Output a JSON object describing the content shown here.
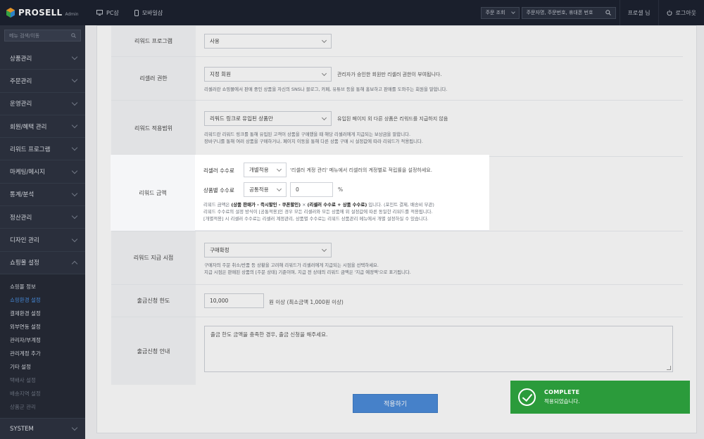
{
  "app": {
    "brand": "PROSELL",
    "brand_sub": "Admin"
  },
  "topbar": {
    "nav": [
      {
        "icon": "monitor-icon",
        "label": "PC샵"
      },
      {
        "icon": "mobile-icon",
        "label": "모바일샵"
      }
    ],
    "order_select": "주문 조회",
    "order_search_placeholder": "주문자명, 주문번호, 휴대폰 번호",
    "profile": "프로셀 님",
    "logout": "로그아웃"
  },
  "sidebar": {
    "search_placeholder": "메뉴 검색/이동",
    "menu": [
      "상품관리",
      "주문관리",
      "운영관리",
      "회원/혜택 관리",
      "리워드 프로그램",
      "마케팅/메시지",
      "통계/분석",
      "정산관리",
      "디자인 관리",
      "쇼핑몰 설정"
    ],
    "sub": [
      "쇼핑몰 정보",
      "쇼핑환경 설정",
      "결제환경 설정",
      "외부연동 설정",
      "관리자/부계정",
      "관리계정 추가",
      "기타 설정",
      "택배사 설정",
      "배송지역 설정",
      "상품군 관리"
    ],
    "system": "SYSTEM"
  },
  "form": {
    "reward_program": {
      "label": "리워드 프로그램",
      "value": "사용"
    },
    "reseller_auth": {
      "label": "리셀러 권한",
      "value": "지정 회원",
      "note": "관리자가 승인한 회원만 리셀러 권한이 부여됩니다.",
      "help": "리셀러란 쇼핑몰에서 판매 중인 상품을 자신의 SNS나 블로그, 카페, 유튜브 등을 통해 홍보하고 판매를 도와주는 회원을 말합니다."
    },
    "reward_scope": {
      "label": "리워드 적용범위",
      "value": "리워드 링크로 유입된 상품만",
      "note": "유입된 페이지 외 다른 상품은 리워드를 지급하지 않음",
      "help1": "리워드란 리워드 링크를 통해 유입된 고객이 상품을 구매했을 때 해당 리셀러에게 지급되는 보상금을 말합니다.",
      "help2": "장바구니를 통해 여러 상품을 구매하거나, 페이지 이동을 통해 다른 상품 구매 시 설정값에 따라 리워드가 적용됩니다."
    },
    "reward_amount": {
      "label": "리워드 금액",
      "reseller_rate_label": "리셀러 수수료",
      "reseller_rate_value": "개별적용",
      "reseller_rate_note": "'리셀러 계정 관리' 메뉴에서 리셀러의 계정별로 적립률을 설정하세요.",
      "product_rate_label": "상품별 수수료",
      "product_rate_value": "공통적용",
      "product_rate_input": "0",
      "product_rate_unit": "%",
      "help1_pre": "리워드 금액은 ",
      "help1_bold1": "(상품 판매가 - 즉시할인 - 쿠폰할인)",
      "help1_mid": " × ",
      "help1_bold2": "(리셀러 수수료 + 상품 수수료)",
      "help1_post": " 입니다. (포인트 결제, 배송비 무관)",
      "help2": "리워드 수수료의 설정 방식이 [공통적용]인 경우 모든 리셀러와 모든 상품에 위 설정값에 따른 동일한 리워드를 적용됩니다.",
      "help3": "[개별적용] 시 리셀러 수수료는 리셀러 계정관리, 상품별 수수료는 리워드 상품관리 메뉴에서 개별 설정하실 수 있습니다."
    },
    "payout_time": {
      "label": "리워드 지급 시점",
      "value": "구매확정",
      "help1": "구매자의 주문 취소/반품 등 상황을 고려해 리워드가 리셀러에게 지급되는 시점을 선택하세요.",
      "help2": "지급 시점은 판매된 상품의 [주문 상태] 기준이며, 지급 전 상태의 리워드 금액은 '지급 예정액'으로 표기됩니다."
    },
    "withdraw_limit": {
      "label": "출금신청 한도",
      "value": "10,000",
      "note": "원 이상 (최소금액 1,000원 이상)"
    },
    "withdraw_notice": {
      "label": "출금신청 안내",
      "value": "출금 한도 금액을 충족한 경우, 출금 신청을 해주세요."
    }
  },
  "apply_button": "적용하기",
  "toast": {
    "title": "COMPLETE",
    "message": "적용되었습니다."
  }
}
